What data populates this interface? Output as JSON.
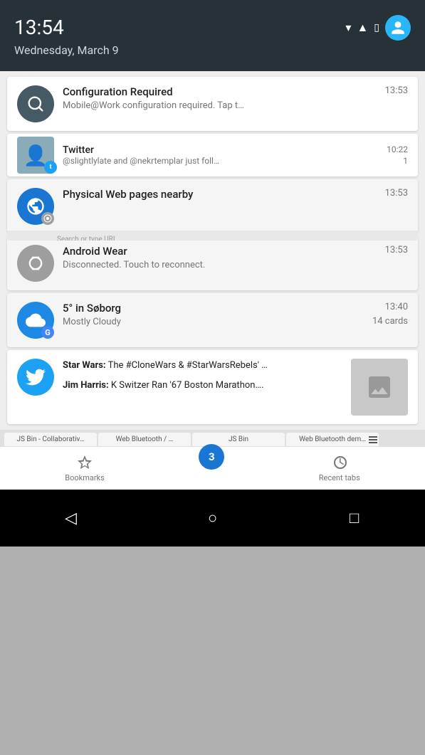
{
  "statusBar": {
    "time": "13:54",
    "date": "Wednesday, March 9"
  },
  "notifications": [
    {
      "id": "config",
      "icon": "settings",
      "iconColor": "teal",
      "title": "Configuration Required",
      "time": "13:53",
      "body": "Mobile@Work configuration required. Tap t…"
    },
    {
      "id": "twitter-partial",
      "iconColor": "twitter",
      "title": "Twitter",
      "time": "10:22",
      "body": "@slightlylate and @nekrtemplar just foll…",
      "count": "1"
    },
    {
      "id": "physical-web",
      "icon": "wifi",
      "iconColor": "blue",
      "title": "Physical Web pages nearby",
      "time": "13:53",
      "body": ""
    },
    {
      "id": "android-wear",
      "icon": "watch",
      "iconColor": "grey",
      "title": "Android Wear",
      "time": "13:53",
      "body": "Disconnected. Touch to reconnect."
    },
    {
      "id": "weather",
      "icon": "cloud",
      "iconColor": "blue-cloud",
      "title": "5° in Søborg",
      "time": "13:40",
      "body": "Mostly Cloudy",
      "extra": "14 cards"
    },
    {
      "id": "twitter-full",
      "iconColor": "twitter-blue",
      "tweet1": {
        "author": "Star Wars:",
        "text": "The #CloneWars & #StarWarsRebels' …"
      },
      "tweet2": {
        "author": "Jim Harris:",
        "text": "K Switzer Ran '67 Boston Marathon…."
      }
    }
  ],
  "browserTabs": [
    {
      "label": "JS Bin - Collaborativ…"
    },
    {
      "label": "Web Bluetooth / …"
    },
    {
      "label": "JS Bin"
    },
    {
      "label": "Web Bluetooth dem…"
    }
  ],
  "chromeBottom": {
    "bookmarksLabel": "Bookmarks",
    "recentTabsLabel": "Recent tabs",
    "tabCount": "3"
  },
  "systemNav": {
    "backSymbol": "◁",
    "homeSymbol": "○",
    "recentSymbol": "□"
  }
}
